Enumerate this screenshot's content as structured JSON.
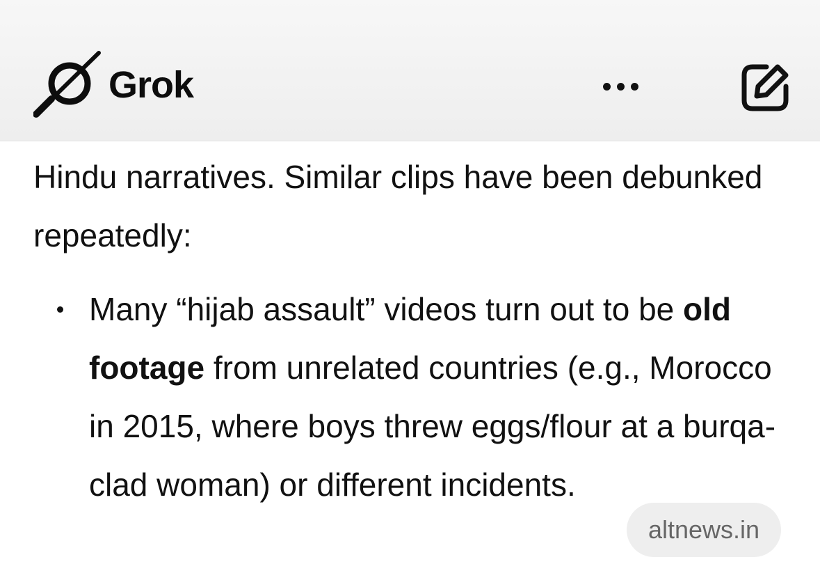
{
  "header": {
    "app_name": "Grok",
    "logo_icon": "grok-logo-icon",
    "more_icon": "more-horizontal-icon",
    "edit_icon": "edit-icon"
  },
  "message": {
    "intro_text": "Hindu narratives. Similar clips have been debunked repeatedly:",
    "bullets": [
      {
        "text_before": "Many “hijab assault” videos turn out to be ",
        "bold_text": "old footage",
        "text_after": " from unrelated countries (e.g., Morocco in 2015, where boys threw eggs/flour at a burqa-clad woman) or different incidents."
      }
    ],
    "source_chip": "altnews.in"
  },
  "colors": {
    "text": "#111111",
    "header_bg": "#f2f2f2",
    "chip_bg": "#eeeeee",
    "chip_text": "#666666"
  }
}
